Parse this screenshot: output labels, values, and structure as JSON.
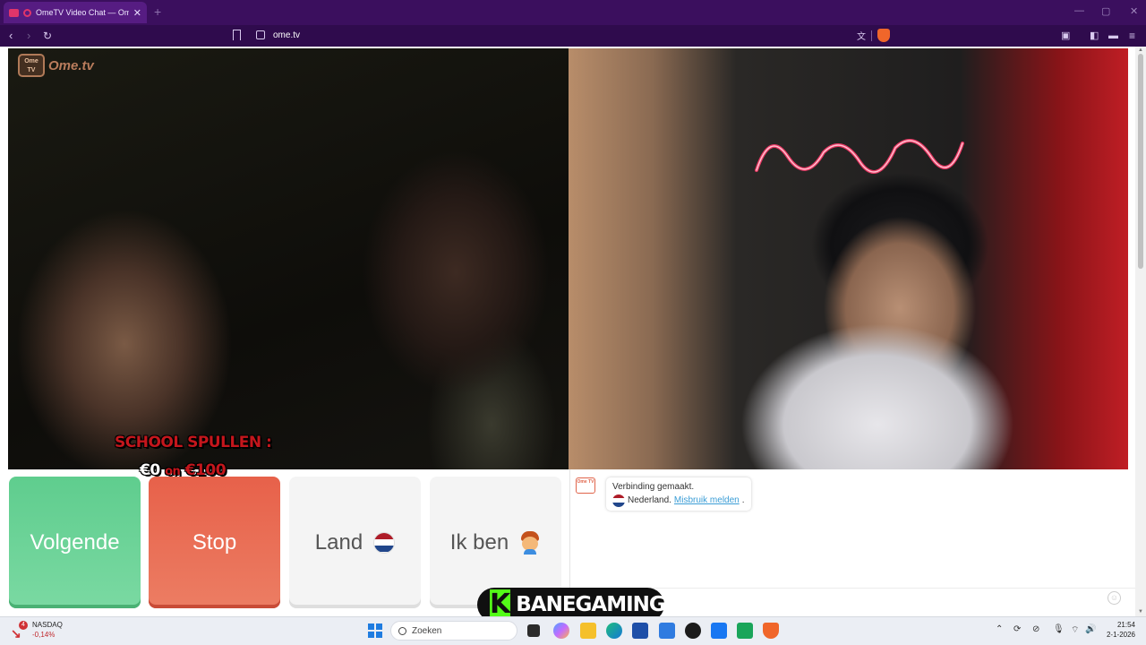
{
  "browser": {
    "tab_title": "OmeTV Video Chat — Omeg",
    "tab_close": "✕",
    "new_tab": "+",
    "url": "ome.tv",
    "window_controls": [
      "—",
      "▢",
      "✕"
    ]
  },
  "video": {
    "logo_box": "Ome TV",
    "logo_text": "Ome.tv",
    "overlay_line1": "SCHOOL SPULLEN :",
    "overlay_line2_start": "€0",
    "overlay_line2_on": "on",
    "overlay_line2_end": "€100"
  },
  "buttons": {
    "next": "Volgende",
    "stop": "Stop",
    "country": "Land",
    "i_am": "Ik ben"
  },
  "chat": {
    "logo": "Ome TV",
    "status": "Verbinding gemaakt.",
    "country": "Nederland.",
    "report_link": "Misbruik melden",
    "period": ".",
    "smiley": "☺"
  },
  "banner": {
    "icon_letter": "K",
    "name": "BANEGAMINGX",
    "accent": "#53fc18"
  },
  "taskbar": {
    "stock_name": "NASDAQ",
    "stock_change": "-0,14%",
    "stock_badge": "4",
    "search_placeholder": "Zoeken",
    "time": "21:54",
    "date": "2-1-2026"
  },
  "colors": {
    "browser_frame": "#3b0f5e",
    "next_green": "#5fcd8e",
    "stop_red": "#e7614a",
    "link_blue": "#3a9dd6"
  }
}
